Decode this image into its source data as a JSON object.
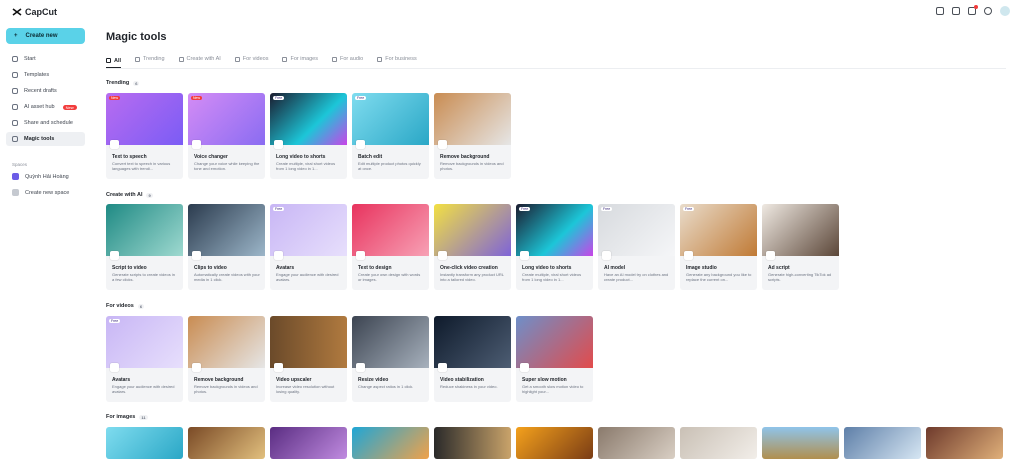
{
  "app": {
    "name": "CapCut"
  },
  "sidebar": {
    "create_label": "Create new",
    "items": [
      {
        "label": "Start"
      },
      {
        "label": "Templates"
      },
      {
        "label": "Recent drafts"
      },
      {
        "label": "AI asset hub",
        "badge": "New"
      },
      {
        "label": "Share and schedule"
      },
      {
        "label": "Magic tools"
      }
    ],
    "spaces_title": "Spaces",
    "spaces": [
      {
        "label": "Quỳnh Hải Hoàng"
      },
      {
        "label": "Create new space"
      }
    ]
  },
  "header": {
    "title": "Magic tools",
    "notification_count": "1"
  },
  "tabs": [
    {
      "label": "All"
    },
    {
      "label": "Trending"
    },
    {
      "label": "Create with AI"
    },
    {
      "label": "For videos"
    },
    {
      "label": "For images"
    },
    {
      "label": "For audio"
    },
    {
      "label": "For business"
    }
  ],
  "sections": [
    {
      "title": "Trending",
      "count": "6",
      "cards": [
        {
          "title": "Text to speech",
          "desc": "Convert text to speech in various languages with trendi...",
          "tag": "New"
        },
        {
          "title": "Voice changer",
          "desc": "Change your voice while keeping the tone and emotion.",
          "tag": "New"
        },
        {
          "title": "Long video to shorts",
          "desc": "Create multiple, viral short videos from 1 long video in 1...",
          "tag": "Free"
        },
        {
          "title": "Batch edit",
          "desc": "Edit multiple product photos quickly at once.",
          "tag": "Free"
        },
        {
          "title": "Remove background",
          "desc": "Remove backgrounds in videos and photos.",
          "tag": ""
        }
      ]
    },
    {
      "title": "Create with AI",
      "count": "9",
      "cards": [
        {
          "title": "Script to video",
          "desc": "Generate scripts to create videos in a few clicks.",
          "tag": ""
        },
        {
          "title": "Clips to video",
          "desc": "Automatically create videos with your media in 1 click.",
          "tag": ""
        },
        {
          "title": "Avatars",
          "desc": "Engage your audience with desired avatars.",
          "tag": "Free"
        },
        {
          "title": "Text to design",
          "desc": "Create your own design with words or images.",
          "tag": ""
        },
        {
          "title": "One-click video creation",
          "desc": "Instantly transform any product URL into a tailored video.",
          "tag": ""
        },
        {
          "title": "Long video to shorts",
          "desc": "Create multiple, viral short videos from 1 long video in 1...",
          "tag": "Free"
        },
        {
          "title": "AI model",
          "desc": "Have an AI model try on clothes and create product...",
          "tag": "Free"
        },
        {
          "title": "Image studio",
          "desc": "Generate any background you like to replace the current on...",
          "tag": "Free"
        },
        {
          "title": "Ad script",
          "desc": "Generate high-converting TikTok ad scripts.",
          "tag": ""
        }
      ]
    },
    {
      "title": "For videos",
      "count": "6",
      "cards": [
        {
          "title": "Avatars",
          "desc": "Engage your audience with desired avatars.",
          "tag": "Free"
        },
        {
          "title": "Remove background",
          "desc": "Remove backgrounds in videos and photos.",
          "tag": ""
        },
        {
          "title": "Video upscaler",
          "desc": "Increase video resolution without losing quality.",
          "tag": ""
        },
        {
          "title": "Resize video",
          "desc": "Change aspect ratios in 1 click.",
          "tag": ""
        },
        {
          "title": "Video stabilization",
          "desc": "Reduce shakiness in your video.",
          "tag": ""
        },
        {
          "title": "Super slow motion",
          "desc": "Get a smooth slow motion video to highlight your...",
          "tag": ""
        }
      ]
    },
    {
      "title": "For images",
      "count": "11"
    }
  ],
  "colors": {
    "accent": "#5ad2e8",
    "new_badge": "#f23c3c"
  }
}
